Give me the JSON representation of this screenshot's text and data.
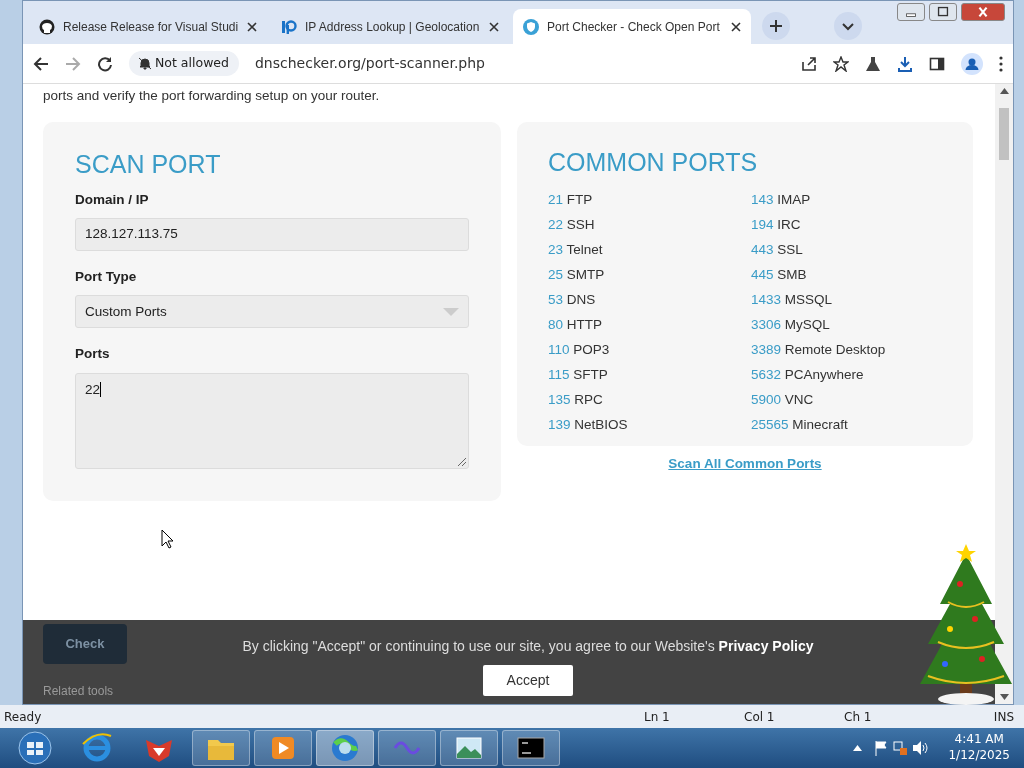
{
  "browser": {
    "tabs": [
      {
        "title": "Release Release for Visual Studi",
        "selected": false
      },
      {
        "title": "IP Address Lookup | Geolocation",
        "selected": false
      },
      {
        "title": "Port Checker - Check Open Port",
        "selected": true
      }
    ],
    "site_permission": "Not allowed",
    "url": "dnschecker.org/port-scanner.php"
  },
  "page": {
    "intro": "ports and verify the port forwarding setup on your router.",
    "scan_port": {
      "title": "SCAN PORT",
      "fields": [
        {
          "label": "Domain / IP",
          "kind": "input",
          "value": "128.127.113.75"
        },
        {
          "label": "Port Type",
          "kind": "select",
          "value": "Custom Ports"
        },
        {
          "label": "Ports",
          "kind": "textarea",
          "value": "22"
        }
      ]
    },
    "common_ports": {
      "title": "COMMON PORTS",
      "ports": [
        {
          "number": "21",
          "name": "FTP"
        },
        {
          "number": "22",
          "name": "SSH"
        },
        {
          "number": "23",
          "name": "Telnet"
        },
        {
          "number": "25",
          "name": "SMTP"
        },
        {
          "number": "53",
          "name": "DNS"
        },
        {
          "number": "80",
          "name": "HTTP"
        },
        {
          "number": "110",
          "name": "POP3"
        },
        {
          "number": "115",
          "name": "SFTP"
        },
        {
          "number": "135",
          "name": "RPC"
        },
        {
          "number": "139",
          "name": "NetBIOS"
        },
        {
          "number": "143",
          "name": "IMAP"
        },
        {
          "number": "194",
          "name": "IRC"
        },
        {
          "number": "443",
          "name": "SSL"
        },
        {
          "number": "445",
          "name": "SMB"
        },
        {
          "number": "1433",
          "name": "MSSQL"
        },
        {
          "number": "3306",
          "name": "MySQL"
        },
        {
          "number": "3389",
          "name": "Remote Desktop"
        },
        {
          "number": "5632",
          "name": "PCAnywhere"
        },
        {
          "number": "5900",
          "name": "VNC"
        },
        {
          "number": "25565",
          "name": "Minecraft"
        }
      ]
    },
    "scan_all_link": "Scan All Common Ports",
    "check_button": "Check",
    "related_tools": "Related tools",
    "cookie_banner": {
      "text": "By clicking \"Accept\" or continuing to use our site, you agree to our Website's",
      "link": "Privacy Policy",
      "button": "Accept"
    }
  },
  "editor_status": [
    "Ready",
    "Ln 1",
    "Col 1",
    "Ch 1",
    "INS"
  ],
  "taskbar": {
    "time": "4:41 AM",
    "date": "1/12/2025"
  }
}
